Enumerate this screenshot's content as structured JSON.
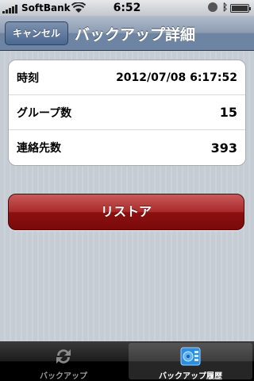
{
  "status_bar": {
    "carrier": "SoftBank",
    "time": "6:52",
    "battery_level": 1.0
  },
  "nav": {
    "cancel_label": "キャンセル",
    "title": "バックアップ詳細"
  },
  "details": [
    {
      "label": "時刻",
      "value": "2012/07/08 6:17:52"
    },
    {
      "label": "グループ数",
      "value": "15"
    },
    {
      "label": "連絡先数",
      "value": "393"
    }
  ],
  "restore_label": "リストア",
  "tabs": [
    {
      "label": "バックアップ",
      "icon": "sync-icon",
      "selected": false
    },
    {
      "label": "バックアップ履歴",
      "icon": "backup-history-icon",
      "selected": true
    }
  ],
  "colors": {
    "nav_tint": "#6d84a2",
    "restore": "#a92a2a",
    "background": "#c5ccd4"
  }
}
